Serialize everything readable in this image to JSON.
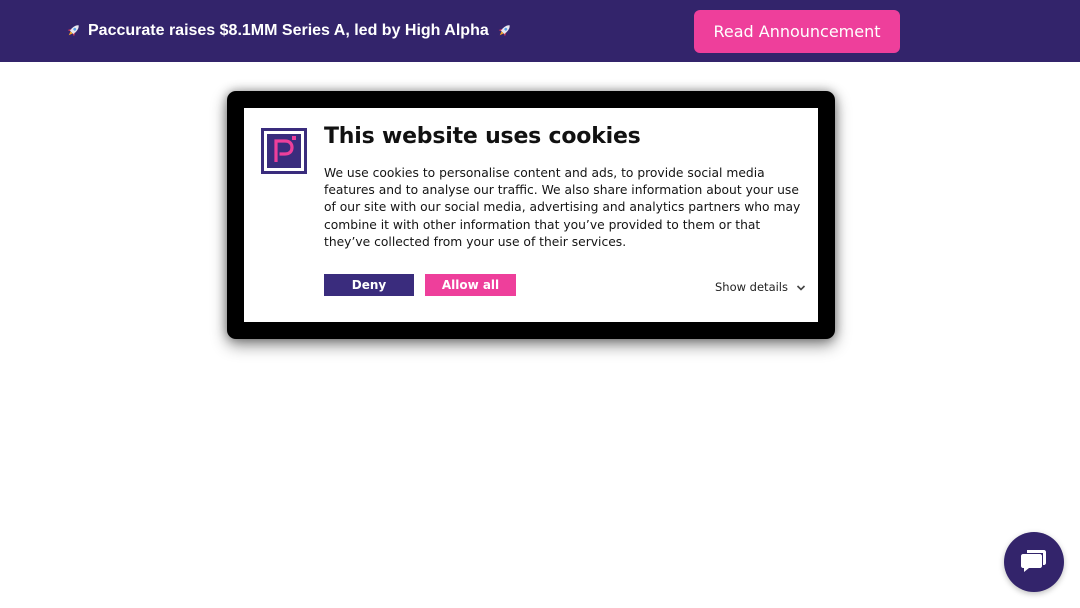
{
  "announcement": {
    "icon_left": "rocket-icon",
    "text": "Paccurate raises $8.1MM Series A, led by High Alpha",
    "icon_right": "rocket-icon",
    "button_label": "Read Announcement",
    "bar_color": "#33246b",
    "button_color": "#ee3f9b"
  },
  "cookie_dialog": {
    "logo_icon": "paccurate-logo",
    "title": "This website uses cookies",
    "body": "We use cookies to personalise content and ads, to provide social media features and to analyse our traffic. We also share information about your use of our site with our social media, advertising and analytics partners who may combine it with other information that you’ve provided to them or that they’ve collected from your use of their services.",
    "deny_label": "Deny",
    "allow_all_label": "Allow all",
    "show_details_label": "Show details",
    "show_details_icon": "chevron-down-icon",
    "deny_color": "#3a2c7d",
    "allow_color": "#ee3f9b"
  },
  "chat_launcher": {
    "icon": "chat-bubble-icon",
    "color": "#33246b"
  }
}
